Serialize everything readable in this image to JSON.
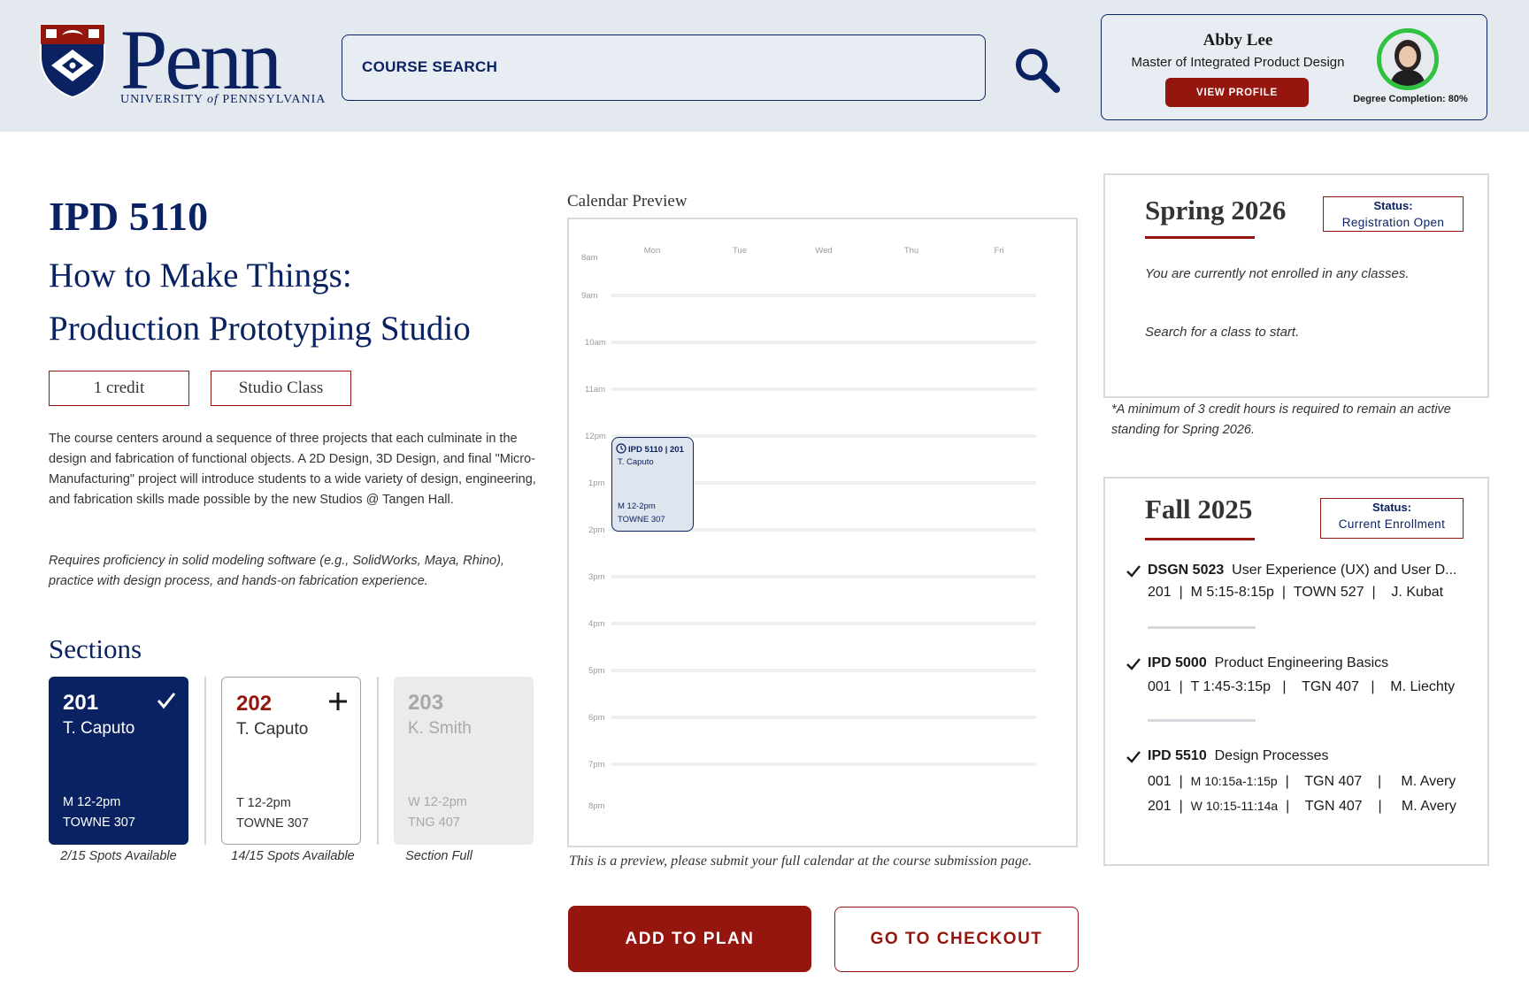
{
  "header": {
    "logo_word": "Penn",
    "logo_sub_1": "UNIVERSITY",
    "logo_sub_2": "of",
    "logo_sub_3": "PENNSYLVANIA",
    "search_placeholder": "COURSE SEARCH",
    "profile": {
      "name": "Abby Lee",
      "program": "Master of Integrated Product Design",
      "button_label": "VIEW PROFILE",
      "degree_completion": "Degree Completion: 80%",
      "ring_color": "#2fc23f"
    }
  },
  "course": {
    "code": "IPD 5110",
    "title_line1": "How to Make Things:",
    "title_line2": "Production Prototyping Studio",
    "tags": [
      "1 credit",
      "Studio Class"
    ],
    "description": "The course centers around a sequence of three projects that each culminate in the design and fabrication of functional objects. A 2D Design, 3D Design, and final \"Micro-Manufacturing\" project will introduce students to a wide variety of design, engineering, and fabrication skills made possible by the new Studios @ Tangen Hall.",
    "requirements": "Requires proficiency in solid modeling software (e.g., SolidWorks, Maya, Rhino), practice with design process, and hands-on fabrication experience."
  },
  "sections": {
    "heading": "Sections",
    "items": [
      {
        "number": "201",
        "instructor": "T. Caputo",
        "time": "M 12-2pm",
        "room": "TOWNE 307",
        "spots": "2/15 Spots Available",
        "state": "selected"
      },
      {
        "number": "202",
        "instructor": "T. Caputo",
        "time": "T 12-2pm",
        "room": "TOWNE 307",
        "spots": "14/15 Spots Available",
        "state": "open"
      },
      {
        "number": "203",
        "instructor": "K. Smith",
        "time": "W 12-2pm",
        "room": "TNG 407",
        "spots": "Section Full",
        "state": "full"
      }
    ]
  },
  "calendar": {
    "label": "Calendar Preview",
    "days": [
      "Mon",
      "Tue",
      "Wed",
      "Thu",
      "Fri"
    ],
    "hours": [
      "8am",
      "9am",
      "10am",
      "11am",
      "12pm",
      "1pm",
      "2pm",
      "3pm",
      "4pm",
      "5pm",
      "6pm",
      "7pm",
      "8pm"
    ],
    "event": {
      "title": "IPD 5110 | 201",
      "instructor": "T. Caputo",
      "time": "M 12-2pm",
      "room": "TOWNE 307"
    },
    "note": "This is a preview, please submit your full calendar at the course submission page."
  },
  "actions": {
    "add_to_plan": "ADD TO PLAN",
    "checkout": "GO TO CHECKOUT"
  },
  "spring": {
    "term": "Spring 2026",
    "status_label": "Status:",
    "status_value": "Registration Open",
    "message_1": "You are currently not enrolled in any classes.",
    "message_2": "Search for a class to start.",
    "min_note": "*A minimum of 3 credit hours is required to remain an active standing for Spring 2026."
  },
  "fall": {
    "term": "Fall 2025",
    "status_label": "Status:",
    "status_value": "Current Enrollment",
    "courses": [
      {
        "code": "DSGN 5023",
        "name": "User Experience (UX) and User D...",
        "rows": [
          [
            "201",
            "M 5:15-8:15p",
            "TOWN 527",
            "J. Kubat"
          ]
        ]
      },
      {
        "code": "IPD 5000",
        "name": "Product Engineering Basics",
        "rows": [
          [
            "001",
            "T 1:45-3:15p",
            "TGN 407",
            "M. Liechty"
          ]
        ]
      },
      {
        "code": "IPD 5510",
        "name": "Design Processes",
        "rows": [
          [
            "001",
            "M 10:15a-1:15p",
            "TGN 407",
            "M. Avery"
          ],
          [
            "201",
            "W 10:15-11:14a",
            "TGN 407",
            "M. Avery"
          ]
        ]
      }
    ]
  },
  "colors": {
    "navy": "#0a2261",
    "red": "#95150f",
    "header_bg": "#e4e9f0"
  }
}
